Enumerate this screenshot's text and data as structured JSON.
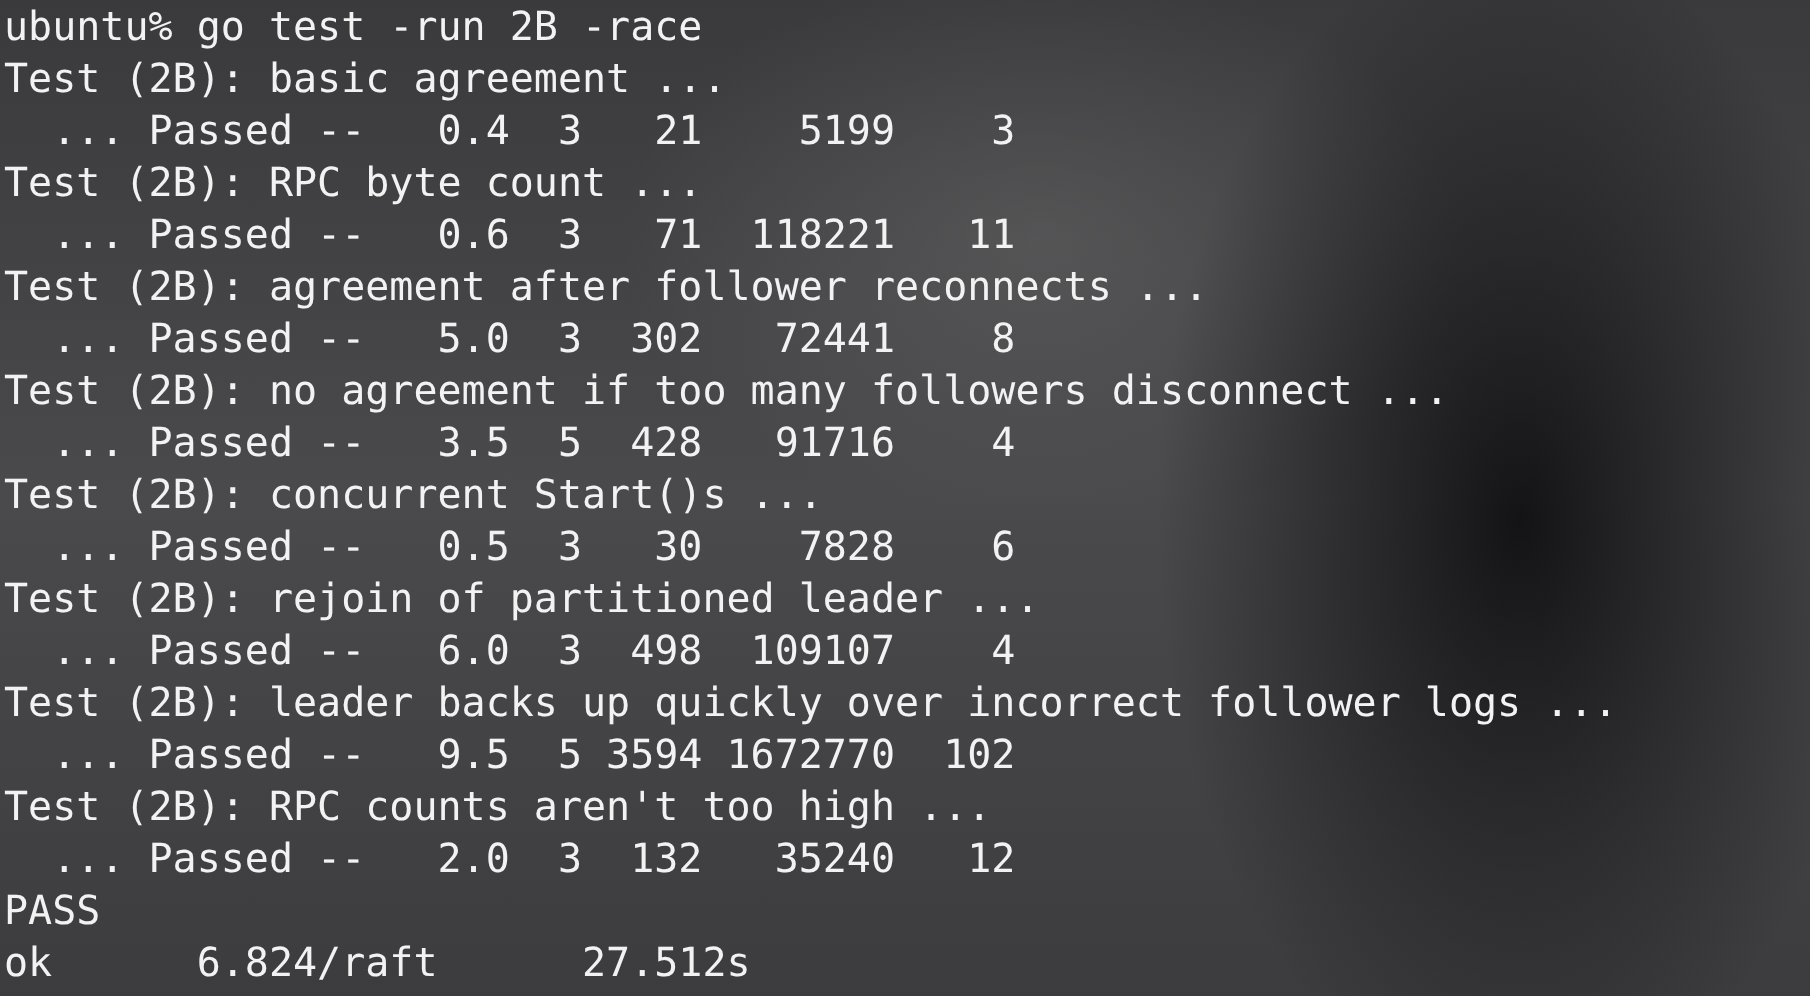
{
  "terminal": {
    "command_line": "ubuntu% go test -run 2B -race",
    "tests": [
      {
        "title": "Test (2B): basic agreement ...",
        "result": "  ... Passed --   0.4  3   21    5199    3"
      },
      {
        "title": "Test (2B): RPC byte count ...",
        "result": "  ... Passed --   0.6  3   71  118221   11"
      },
      {
        "title": "Test (2B): agreement after follower reconnects ...",
        "result": "  ... Passed --   5.0  3  302   72441    8"
      },
      {
        "title": "Test (2B): no agreement if too many followers disconnect ...",
        "result": "  ... Passed --   3.5  5  428   91716    4"
      },
      {
        "title": "Test (2B): concurrent Start()s ...",
        "result": "  ... Passed --   0.5  3   30    7828    6"
      },
      {
        "title": "Test (2B): rejoin of partitioned leader ...",
        "result": "  ... Passed --   6.0  3  498  109107    4"
      },
      {
        "title": "Test (2B): leader backs up quickly over incorrect follower logs ...",
        "result": "  ... Passed --   9.5  5 3594 1672770  102"
      },
      {
        "title": "Test (2B): RPC counts aren't too high ...",
        "result": "  ... Passed --   2.0  3  132   35240   12"
      }
    ],
    "summary": [
      "PASS",
      "ok      6.824/raft      27.512s"
    ]
  }
}
